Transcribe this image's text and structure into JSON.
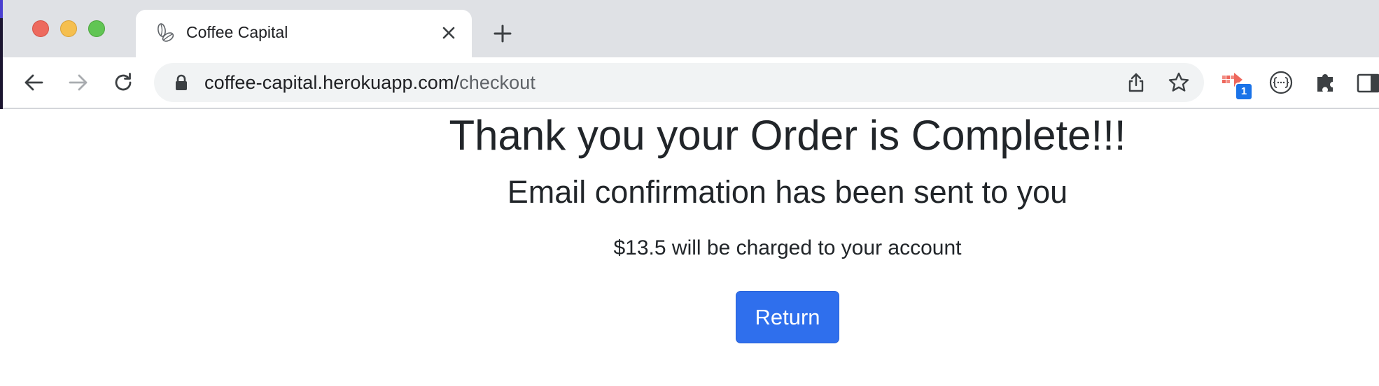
{
  "browser": {
    "tab": {
      "title": "Coffee Capital",
      "favicon": "coffee-beans-icon"
    },
    "address": {
      "domain": "coffee-capital.herokuapp.com/",
      "path": "checkout"
    },
    "extensions": {
      "badge_count": "1"
    },
    "colors": {
      "tabbar": "#dfe1e5",
      "omnibox": "#f1f3f4",
      "badge": "#1a73e8"
    }
  },
  "page": {
    "heading": "Thank you your Order is Complete!!!",
    "subheading": "Email confirmation has been sent to you",
    "charge_text": "$13.5 will be charged to your account",
    "return_label": "Return",
    "colors": {
      "primary_button": "#2f6fed",
      "text": "#212529"
    }
  }
}
